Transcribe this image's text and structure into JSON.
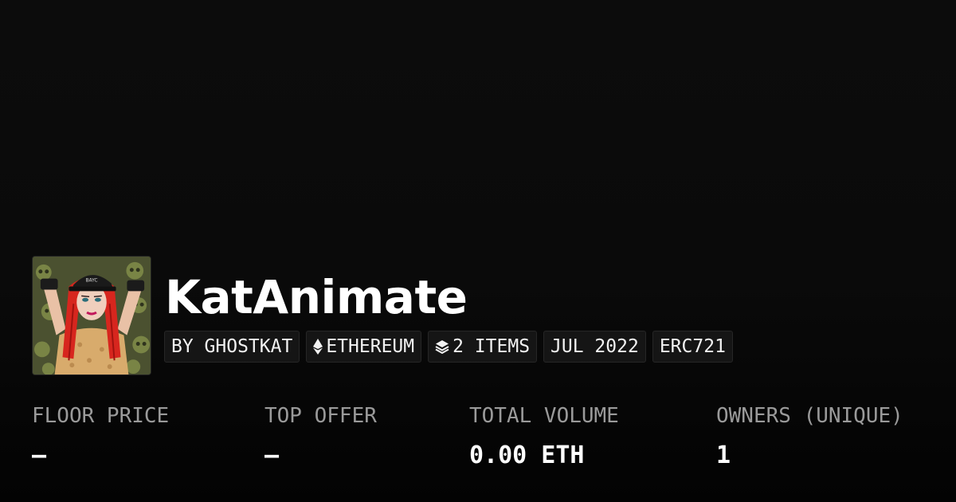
{
  "collection": {
    "name": "KatAnimate",
    "avatar_description": "anime-style girl with red hair, black cap and skull pattern background"
  },
  "badges": {
    "creator": "BY GHOSTKAT",
    "chain": "ETHEREUM",
    "chain_icon": "ethereum-icon",
    "items": "2 ITEMS",
    "items_icon": "layers-icon",
    "date": "JUL 2022",
    "standard": "ERC721"
  },
  "stats": {
    "floor_price": {
      "label": "FLOOR PRICE",
      "value": "—"
    },
    "top_offer": {
      "label": "TOP OFFER",
      "value": "—"
    },
    "total_volume": {
      "label": "TOTAL VOLUME",
      "value": "0.00 ETH"
    },
    "owners": {
      "label": "OWNERS (UNIQUE)",
      "value": "1"
    }
  },
  "colors": {
    "background": "#0a0a0a",
    "text_primary": "#ffffff",
    "text_muted": "#9a9a9a",
    "badge_bg": "#151515",
    "badge_border": "#262626",
    "avatar_hair": "#d7261e",
    "avatar_bg": "#4b5130"
  }
}
